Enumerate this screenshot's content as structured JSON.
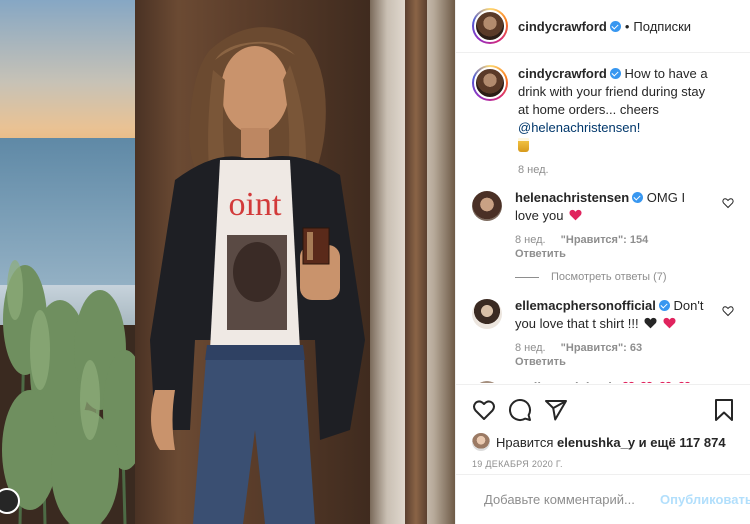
{
  "post": {
    "author": "cindycrawford",
    "follow_label": "Подписки",
    "dot": "•"
  },
  "caption": {
    "user": "cindycrawford",
    "text": "How to have a drink with your friend during stay at home orders... cheers",
    "mention": "@helenachristensen!",
    "time": "8 нед."
  },
  "comments": [
    {
      "user": "helenachristensen",
      "text": "OMG I love you",
      "time": "8 нед.",
      "likes": "\"Нравится\": 154",
      "reply": "Ответить",
      "view_replies": "Посмотреть ответы (7)"
    },
    {
      "user": "ellemacphersonofficial",
      "text": "Don't you love that t shirt !!!",
      "time": "8 нед.",
      "likes": "\"Нравится\": 63",
      "reply": "Ответить"
    },
    {
      "user": "melissaodabash",
      "text": ""
    }
  ],
  "likes_line": {
    "prefix": "Нравится",
    "user": "elenushka_y",
    "suffix": "и ещё 117 874"
  },
  "date": "19 декабря 2020 г.",
  "add_comment": {
    "placeholder": "Добавьте комментарий...",
    "publish": "Опубликовать"
  },
  "icons": [
    "heart-icon",
    "comment-icon",
    "share-icon",
    "bookmark-icon",
    "smile-icon",
    "verified-icon"
  ],
  "colors": {
    "accent": "#3897f0",
    "publish": "#b2dffc",
    "heart": "#ed4956",
    "muted": "#8e8e8e"
  }
}
